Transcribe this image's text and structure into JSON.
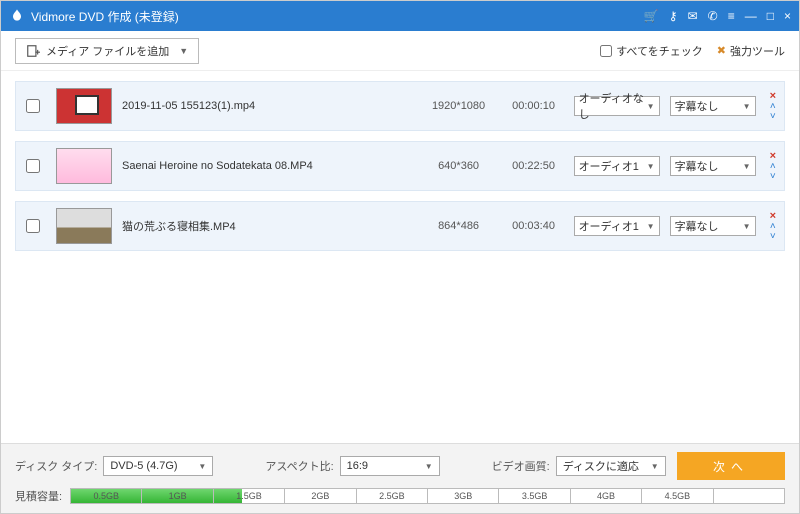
{
  "titlebar": {
    "title": "Vidmore DVD 作成 (未登録)"
  },
  "toolbar": {
    "add_label": "メディア ファイルを追加",
    "check_all_label": "すべてをチェック",
    "tools_label": "強力ツール"
  },
  "files": [
    {
      "name": "2019-11-05 155123(1).mp4",
      "resolution": "1920*1080",
      "duration": "00:00:10",
      "audio": "オーディオなし",
      "subtitle": "字幕なし"
    },
    {
      "name": "Saenai Heroine no Sodatekata 08.MP4",
      "resolution": "640*360",
      "duration": "00:22:50",
      "audio": "オーディオ1",
      "subtitle": "字幕なし"
    },
    {
      "name": "猫の荒ぶる寝相集.MP4",
      "resolution": "864*486",
      "duration": "00:03:40",
      "audio": "オーディオ1",
      "subtitle": "字幕なし"
    }
  ],
  "bottom": {
    "disc_type_label": "ディスク タイプ:",
    "disc_type_value": "DVD-5 (4.7G)",
    "aspect_label": "アスペクト比:",
    "aspect_value": "16:9",
    "quality_label": "ビデオ画質:",
    "quality_value": "ディスクに適応",
    "capacity_label": "見積容量:",
    "next_label": "次へ",
    "fill_percent": 24,
    "ticks": [
      "0.5GB",
      "1GB",
      "1.5GB",
      "2GB",
      "2.5GB",
      "3GB",
      "3.5GB",
      "4GB",
      "4.5GB",
      ""
    ]
  }
}
